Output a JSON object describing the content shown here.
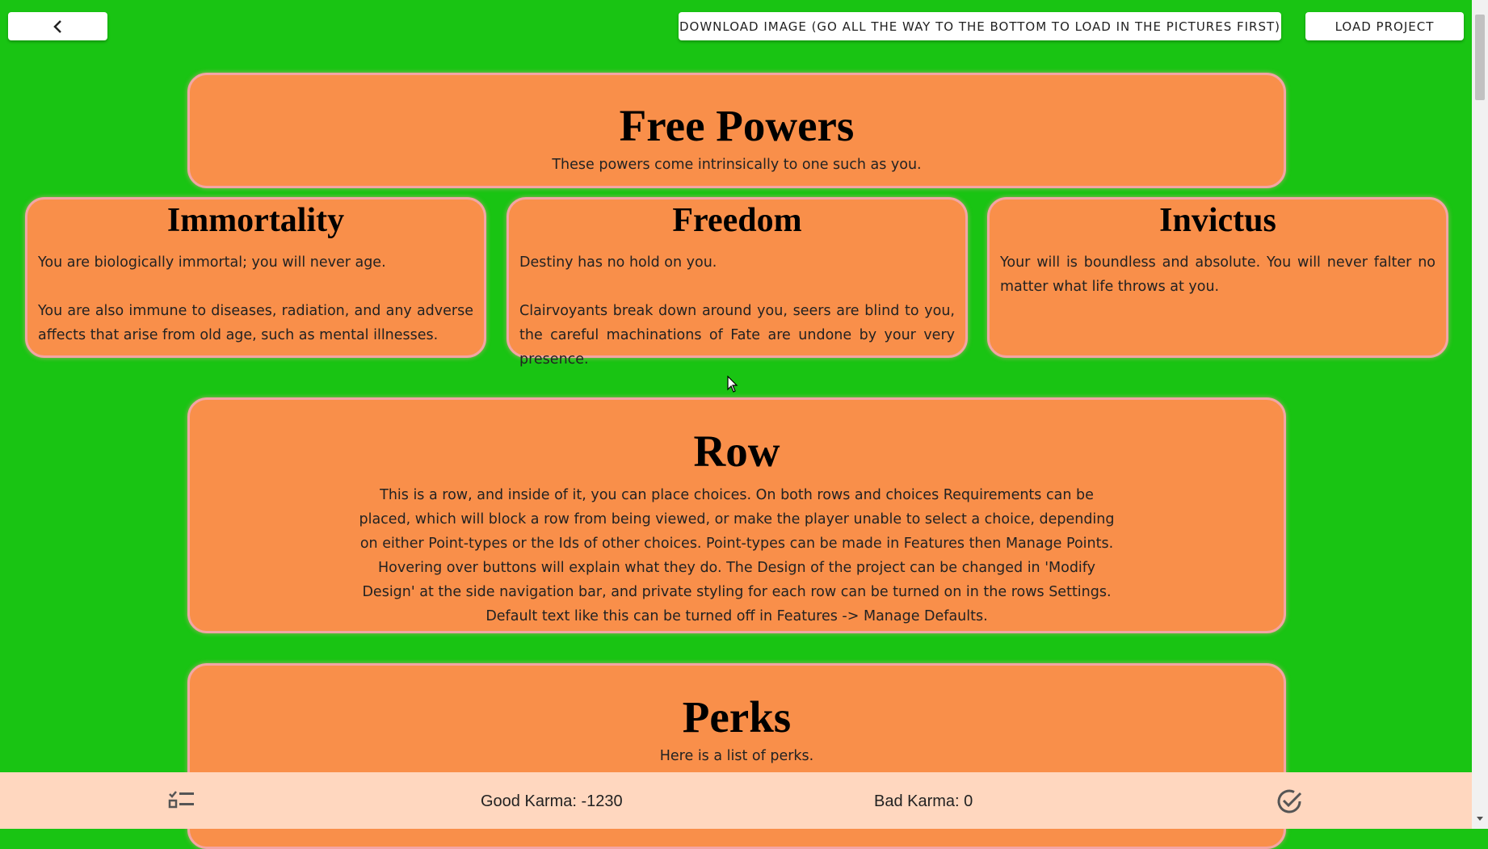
{
  "topbar": {
    "back_icon": "chevron-left-icon",
    "download_label": "DOWNLOAD IMAGE (GO ALL THE WAY TO THE BOTTOM TO LOAD IN THE PICTURES FIRST)",
    "load_label": "LOAD PROJECT"
  },
  "free_powers": {
    "title": "Free Powers",
    "text": "These powers come intrinsically to one such as you.",
    "choices": [
      {
        "title": "Immortality",
        "text": "You are biologically immortal; you will never age.\n\nYou are also immune to diseases, radiation, and any adverse affects that arise from old age, such as mental illnesses."
      },
      {
        "title": "Freedom",
        "text": "Destiny has no hold on you.\n\nClairvoyants break down around you, seers are blind to you, the careful machinations of Fate are undone by your very presence."
      },
      {
        "title": "Invictus",
        "text": "Your will is boundless and absolute. You will never falter no matter what life throws at you."
      }
    ]
  },
  "row": {
    "title": "Row",
    "text": "This is a row, and inside of it, you can place choices. On both rows and choices Requirements can be placed, which will block a row from being viewed, or make the player unable to select a choice, depending on either Point-types or the Ids of other choices. Point-types can be made in Features then Manage Points. Hovering over buttons will explain what they do. The Design of the project can be changed in 'Modify Design' at the side navigation bar, and private styling for each row can be turned on in the rows Settings. Default text like this can be turned off in Features -> Manage Defaults."
  },
  "perks": {
    "title": "Perks",
    "text": "Here is a list of perks."
  },
  "bottombar": {
    "list_icon": "checklist-icon",
    "good_karma": "Good Karma: -1230",
    "bad_karma": "Bad Karma: 0",
    "check_icon": "check-circle-icon"
  },
  "colors": {
    "background": "#19c413",
    "card": "#f98f4a",
    "card_border": "#f3a5a5",
    "bottombar": "#ffd7bf"
  }
}
